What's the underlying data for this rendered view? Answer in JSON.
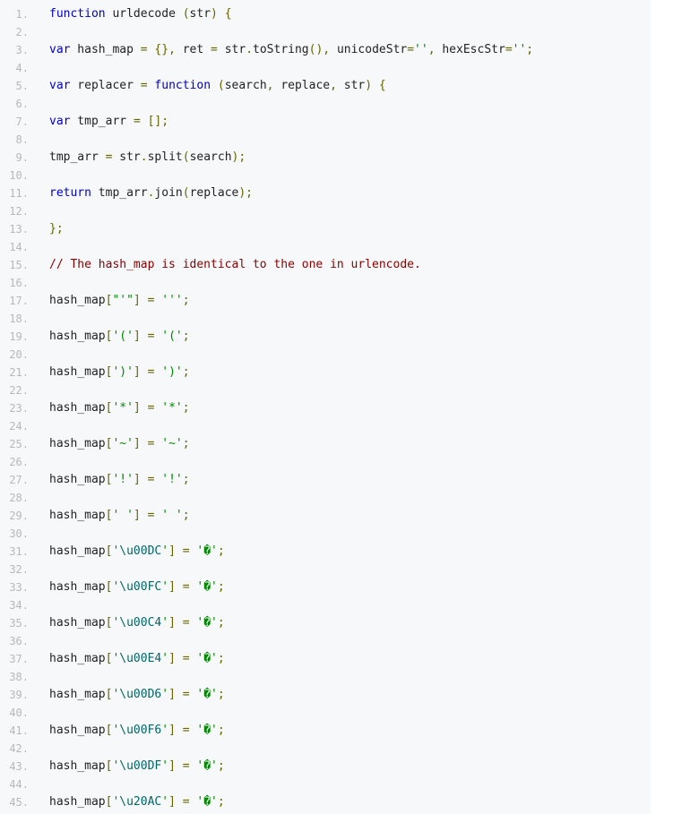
{
  "editor": {
    "colors": {
      "keyword": "#0000cc",
      "plain": "#222222",
      "punctuation": "#666600",
      "string": "#008800",
      "comment": "#880000",
      "escape": "#006666",
      "line_number": "#b8b8b8",
      "background": "#f7f8fa"
    },
    "lines": [
      {
        "num": "1.",
        "tokens": [
          [
            "kw",
            "function"
          ],
          [
            "pl",
            " urldecode "
          ],
          [
            "pu",
            "("
          ],
          [
            "pl",
            "str"
          ],
          [
            "pu",
            ")"
          ],
          [
            "pl",
            " "
          ],
          [
            "pu",
            "{"
          ]
        ]
      },
      {
        "num": "2.",
        "tokens": []
      },
      {
        "num": "3.",
        "tokens": [
          [
            "kw",
            "var"
          ],
          [
            "pl",
            " hash_map "
          ],
          [
            "pu",
            "="
          ],
          [
            "pl",
            " "
          ],
          [
            "pu",
            "{},"
          ],
          [
            "pl",
            " ret "
          ],
          [
            "pu",
            "="
          ],
          [
            "pl",
            " str"
          ],
          [
            "pu",
            "."
          ],
          [
            "pl",
            "toString"
          ],
          [
            "pu",
            "(),"
          ],
          [
            "pl",
            " unicodeStr"
          ],
          [
            "pu",
            "="
          ],
          [
            "st",
            "''"
          ],
          [
            "pu",
            ","
          ],
          [
            "pl",
            " hexEscStr"
          ],
          [
            "pu",
            "="
          ],
          [
            "st",
            "''"
          ],
          [
            "pu",
            ";"
          ]
        ]
      },
      {
        "num": "4.",
        "tokens": []
      },
      {
        "num": "5.",
        "tokens": [
          [
            "kw",
            "var"
          ],
          [
            "pl",
            " replacer "
          ],
          [
            "pu",
            "="
          ],
          [
            "pl",
            " "
          ],
          [
            "kw",
            "function"
          ],
          [
            "pl",
            " "
          ],
          [
            "pu",
            "("
          ],
          [
            "pl",
            "search"
          ],
          [
            "pu",
            ","
          ],
          [
            "pl",
            " replace"
          ],
          [
            "pu",
            ","
          ],
          [
            "pl",
            " str"
          ],
          [
            "pu",
            ")"
          ],
          [
            "pl",
            " "
          ],
          [
            "pu",
            "{"
          ]
        ]
      },
      {
        "num": "6.",
        "tokens": []
      },
      {
        "num": "7.",
        "tokens": [
          [
            "kw",
            "var"
          ],
          [
            "pl",
            " tmp_arr "
          ],
          [
            "pu",
            "="
          ],
          [
            "pl",
            " "
          ],
          [
            "pu",
            "[];"
          ]
        ]
      },
      {
        "num": "8.",
        "tokens": []
      },
      {
        "num": "9.",
        "tokens": [
          [
            "pl",
            "tmp_arr "
          ],
          [
            "pu",
            "="
          ],
          [
            "pl",
            " str"
          ],
          [
            "pu",
            "."
          ],
          [
            "pl",
            "split"
          ],
          [
            "pu",
            "("
          ],
          [
            "pl",
            "search"
          ],
          [
            "pu",
            ");"
          ]
        ]
      },
      {
        "num": "10.",
        "tokens": []
      },
      {
        "num": "11.",
        "tokens": [
          [
            "kw",
            "return"
          ],
          [
            "pl",
            " tmp_arr"
          ],
          [
            "pu",
            "."
          ],
          [
            "pl",
            "join"
          ],
          [
            "pu",
            "("
          ],
          [
            "pl",
            "replace"
          ],
          [
            "pu",
            ");"
          ]
        ]
      },
      {
        "num": "12.",
        "tokens": []
      },
      {
        "num": "13.",
        "tokens": [
          [
            "pu",
            "};"
          ]
        ]
      },
      {
        "num": "14.",
        "tokens": []
      },
      {
        "num": "15.",
        "tokens": [
          [
            "cm",
            "// The hash_map is identical to the one in urlencode."
          ]
        ]
      },
      {
        "num": "16.",
        "tokens": []
      },
      {
        "num": "17.",
        "tokens": [
          [
            "pl",
            "hash_map"
          ],
          [
            "pu",
            "["
          ],
          [
            "st",
            "\"'\""
          ],
          [
            "pu",
            "]"
          ],
          [
            "pl",
            " "
          ],
          [
            "pu",
            "="
          ],
          [
            "pl",
            " "
          ],
          [
            "st",
            "'''"
          ],
          [
            "pu",
            ";"
          ]
        ]
      },
      {
        "num": "18.",
        "tokens": []
      },
      {
        "num": "19.",
        "tokens": [
          [
            "pl",
            "hash_map"
          ],
          [
            "pu",
            "["
          ],
          [
            "st",
            "'('"
          ],
          [
            "pu",
            "]"
          ],
          [
            "pl",
            " "
          ],
          [
            "pu",
            "="
          ],
          [
            "pl",
            " "
          ],
          [
            "st",
            "'('"
          ],
          [
            "pu",
            ";"
          ]
        ]
      },
      {
        "num": "20.",
        "tokens": []
      },
      {
        "num": "21.",
        "tokens": [
          [
            "pl",
            "hash_map"
          ],
          [
            "pu",
            "["
          ],
          [
            "st",
            "')'"
          ],
          [
            "pu",
            "]"
          ],
          [
            "pl",
            " "
          ],
          [
            "pu",
            "="
          ],
          [
            "pl",
            " "
          ],
          [
            "st",
            "')'"
          ],
          [
            "pu",
            ";"
          ]
        ]
      },
      {
        "num": "22.",
        "tokens": []
      },
      {
        "num": "23.",
        "tokens": [
          [
            "pl",
            "hash_map"
          ],
          [
            "pu",
            "["
          ],
          [
            "st",
            "'*'"
          ],
          [
            "pu",
            "]"
          ],
          [
            "pl",
            " "
          ],
          [
            "pu",
            "="
          ],
          [
            "pl",
            " "
          ],
          [
            "st",
            "'*'"
          ],
          [
            "pu",
            ";"
          ]
        ]
      },
      {
        "num": "24.",
        "tokens": []
      },
      {
        "num": "25.",
        "tokens": [
          [
            "pl",
            "hash_map"
          ],
          [
            "pu",
            "["
          ],
          [
            "st",
            "'~'"
          ],
          [
            "pu",
            "]"
          ],
          [
            "pl",
            " "
          ],
          [
            "pu",
            "="
          ],
          [
            "pl",
            " "
          ],
          [
            "st",
            "'~'"
          ],
          [
            "pu",
            ";"
          ]
        ]
      },
      {
        "num": "26.",
        "tokens": []
      },
      {
        "num": "27.",
        "tokens": [
          [
            "pl",
            "hash_map"
          ],
          [
            "pu",
            "["
          ],
          [
            "st",
            "'!'"
          ],
          [
            "pu",
            "]"
          ],
          [
            "pl",
            " "
          ],
          [
            "pu",
            "="
          ],
          [
            "pl",
            " "
          ],
          [
            "st",
            "'!'"
          ],
          [
            "pu",
            ";"
          ]
        ]
      },
      {
        "num": "28.",
        "tokens": []
      },
      {
        "num": "29.",
        "tokens": [
          [
            "pl",
            "hash_map"
          ],
          [
            "pu",
            "["
          ],
          [
            "st",
            "' '"
          ],
          [
            "pu",
            "]"
          ],
          [
            "pl",
            " "
          ],
          [
            "pu",
            "="
          ],
          [
            "pl",
            " "
          ],
          [
            "st",
            "' '"
          ],
          [
            "pu",
            ";"
          ]
        ]
      },
      {
        "num": "30.",
        "tokens": []
      },
      {
        "num": "31.",
        "tokens": [
          [
            "pl",
            "hash_map"
          ],
          [
            "pu",
            "["
          ],
          [
            "st",
            "'"
          ],
          [
            "es",
            "\\u00DC"
          ],
          [
            "st",
            "'"
          ],
          [
            "pu",
            "]"
          ],
          [
            "pl",
            " "
          ],
          [
            "pu",
            "="
          ],
          [
            "pl",
            " "
          ],
          [
            "st",
            "'�'"
          ],
          [
            "pu",
            ";"
          ]
        ]
      },
      {
        "num": "32.",
        "tokens": []
      },
      {
        "num": "33.",
        "tokens": [
          [
            "pl",
            "hash_map"
          ],
          [
            "pu",
            "["
          ],
          [
            "st",
            "'"
          ],
          [
            "es",
            "\\u00FC"
          ],
          [
            "st",
            "'"
          ],
          [
            "pu",
            "]"
          ],
          [
            "pl",
            " "
          ],
          [
            "pu",
            "="
          ],
          [
            "pl",
            " "
          ],
          [
            "st",
            "'�'"
          ],
          [
            "pu",
            ";"
          ]
        ]
      },
      {
        "num": "34.",
        "tokens": []
      },
      {
        "num": "35.",
        "tokens": [
          [
            "pl",
            "hash_map"
          ],
          [
            "pu",
            "["
          ],
          [
            "st",
            "'"
          ],
          [
            "es",
            "\\u00C4"
          ],
          [
            "st",
            "'"
          ],
          [
            "pu",
            "]"
          ],
          [
            "pl",
            " "
          ],
          [
            "pu",
            "="
          ],
          [
            "pl",
            " "
          ],
          [
            "st",
            "'�'"
          ],
          [
            "pu",
            ";"
          ]
        ]
      },
      {
        "num": "36.",
        "tokens": []
      },
      {
        "num": "37.",
        "tokens": [
          [
            "pl",
            "hash_map"
          ],
          [
            "pu",
            "["
          ],
          [
            "st",
            "'"
          ],
          [
            "es",
            "\\u00E4"
          ],
          [
            "st",
            "'"
          ],
          [
            "pu",
            "]"
          ],
          [
            "pl",
            " "
          ],
          [
            "pu",
            "="
          ],
          [
            "pl",
            " "
          ],
          [
            "st",
            "'�'"
          ],
          [
            "pu",
            ";"
          ]
        ]
      },
      {
        "num": "38.",
        "tokens": []
      },
      {
        "num": "39.",
        "tokens": [
          [
            "pl",
            "hash_map"
          ],
          [
            "pu",
            "["
          ],
          [
            "st",
            "'"
          ],
          [
            "es",
            "\\u00D6"
          ],
          [
            "st",
            "'"
          ],
          [
            "pu",
            "]"
          ],
          [
            "pl",
            " "
          ],
          [
            "pu",
            "="
          ],
          [
            "pl",
            " "
          ],
          [
            "st",
            "'�'"
          ],
          [
            "pu",
            ";"
          ]
        ]
      },
      {
        "num": "40.",
        "tokens": []
      },
      {
        "num": "41.",
        "tokens": [
          [
            "pl",
            "hash_map"
          ],
          [
            "pu",
            "["
          ],
          [
            "st",
            "'"
          ],
          [
            "es",
            "\\u00F6"
          ],
          [
            "st",
            "'"
          ],
          [
            "pu",
            "]"
          ],
          [
            "pl",
            " "
          ],
          [
            "pu",
            "="
          ],
          [
            "pl",
            " "
          ],
          [
            "st",
            "'�'"
          ],
          [
            "pu",
            ";"
          ]
        ]
      },
      {
        "num": "42.",
        "tokens": []
      },
      {
        "num": "43.",
        "tokens": [
          [
            "pl",
            "hash_map"
          ],
          [
            "pu",
            "["
          ],
          [
            "st",
            "'"
          ],
          [
            "es",
            "\\u00DF"
          ],
          [
            "st",
            "'"
          ],
          [
            "pu",
            "]"
          ],
          [
            "pl",
            " "
          ],
          [
            "pu",
            "="
          ],
          [
            "pl",
            " "
          ],
          [
            "st",
            "'�'"
          ],
          [
            "pu",
            ";"
          ]
        ]
      },
      {
        "num": "44.",
        "tokens": []
      },
      {
        "num": "45.",
        "tokens": [
          [
            "pl",
            "hash_map"
          ],
          [
            "pu",
            "["
          ],
          [
            "st",
            "'"
          ],
          [
            "es",
            "\\u20AC"
          ],
          [
            "st",
            "'"
          ],
          [
            "pu",
            "]"
          ],
          [
            "pl",
            " "
          ],
          [
            "pu",
            "="
          ],
          [
            "pl",
            " "
          ],
          [
            "st",
            "'�'"
          ],
          [
            "pu",
            ";"
          ]
        ]
      }
    ]
  }
}
